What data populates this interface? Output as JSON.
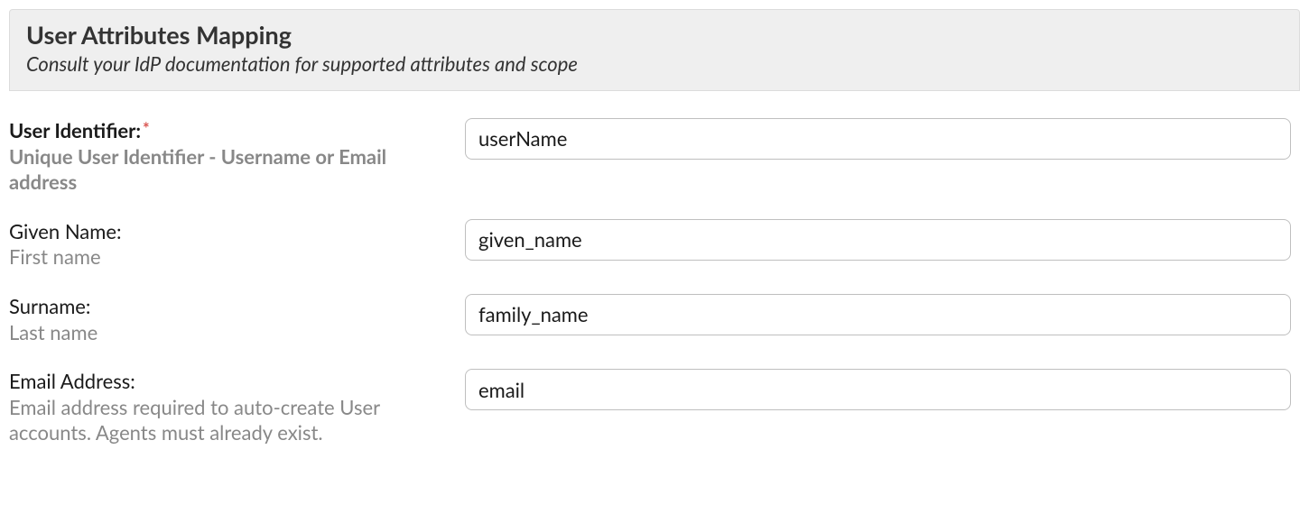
{
  "panel": {
    "title": "User Attributes Mapping",
    "subtitle": "Consult your IdP documentation for supported attributes and scope"
  },
  "fields": {
    "userIdentifier": {
      "label": "User Identifier:",
      "hint": "Unique User Identifier - Username or Email address",
      "value": "userName",
      "required": true
    },
    "givenName": {
      "label": "Given Name:",
      "hint": "First name",
      "value": "given_name"
    },
    "surname": {
      "label": "Surname:",
      "hint": "Last name",
      "value": "family_name"
    },
    "emailAddress": {
      "label": "Email Address:",
      "hint": "Email address required to auto-create User accounts. Agents must already exist.",
      "value": "email"
    }
  }
}
